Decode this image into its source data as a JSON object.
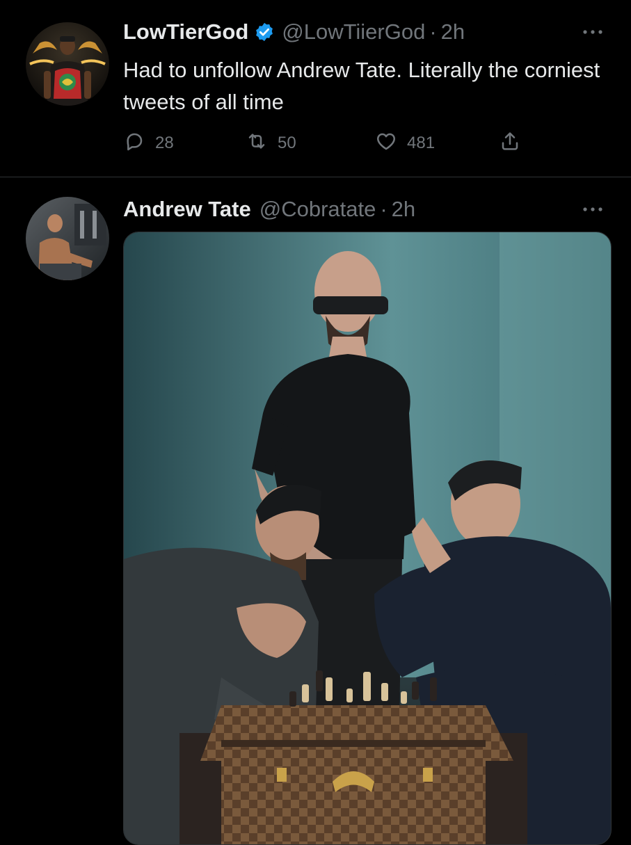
{
  "tweets": [
    {
      "author_name": "LowTierGod",
      "verified": true,
      "handle": "@LowTiierGod",
      "separator": "·",
      "time": "2h",
      "text": "Had to unfollow Andrew Tate. Literally the corniest tweets of all time",
      "stats": {
        "replies": "28",
        "retweets": "50",
        "likes": "481"
      },
      "avatar_icon": "user-avatar"
    },
    {
      "author_name": "Andrew Tate",
      "verified": false,
      "handle": "@Cobratate",
      "separator": "·",
      "time": "2h",
      "media_icon": "photo-chess-scene",
      "avatar_icon": "user-avatar"
    }
  ],
  "icons": {
    "more": "more-icon",
    "reply": "reply-icon",
    "retweet": "retweet-icon",
    "like": "like-icon",
    "share": "share-icon",
    "verified": "verified-badge-icon"
  },
  "colors": {
    "background": "#000000",
    "text_primary": "#e7e9ea",
    "text_secondary": "#71767b",
    "divider": "#2f3336",
    "verified_blue": "#1d9bf0"
  }
}
